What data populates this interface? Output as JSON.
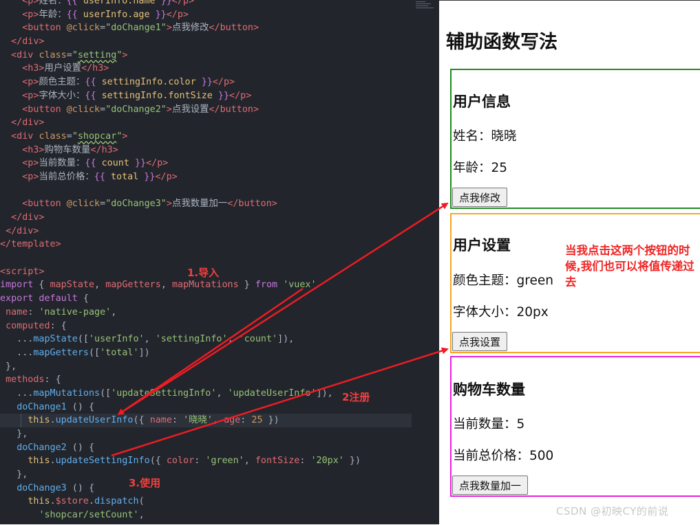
{
  "editor": {
    "lines": [
      [
        [
          "t-pun",
          "    "
        ],
        [
          "t-tag",
          "<p>"
        ],
        [
          "t-txt",
          "姓名："
        ],
        [
          "t-mus",
          "{{ "
        ],
        [
          "t-var",
          "userInfo.name"
        ],
        [
          "t-mus",
          " }}"
        ],
        [
          "t-tag",
          "</p>"
        ]
      ],
      [
        [
          "t-pun",
          "    "
        ],
        [
          "t-tag",
          "<p>"
        ],
        [
          "t-txt",
          "年龄："
        ],
        [
          "t-mus",
          "{{ "
        ],
        [
          "t-var",
          "userInfo.age"
        ],
        [
          "t-mus",
          " }}"
        ],
        [
          "t-tag",
          "</p>"
        ]
      ],
      [
        [
          "t-pun",
          "    "
        ],
        [
          "t-tag",
          "<button "
        ],
        [
          "t-attr",
          "@click"
        ],
        [
          "t-pun",
          "="
        ],
        [
          "t-str",
          "\"doChange1\""
        ],
        [
          "t-tag",
          ">"
        ],
        [
          "t-txt",
          "点我修改"
        ],
        [
          "t-tag",
          "</button>"
        ]
      ],
      [
        [
          "t-pun",
          "  "
        ],
        [
          "t-tag",
          "</div>"
        ]
      ],
      [
        [
          "t-pun",
          "  "
        ],
        [
          "t-tag",
          "<div "
        ],
        [
          "t-attr",
          "class"
        ],
        [
          "t-pun",
          "="
        ],
        [
          "t-str",
          "\""
        ],
        [
          "t-cls",
          "setting"
        ],
        [
          "t-str",
          "\""
        ],
        [
          "t-tag",
          ">"
        ]
      ],
      [
        [
          "t-pun",
          "    "
        ],
        [
          "t-tag",
          "<h3>"
        ],
        [
          "t-txt",
          "用户设置"
        ],
        [
          "t-tag",
          "</h3>"
        ]
      ],
      [
        [
          "t-pun",
          "    "
        ],
        [
          "t-tag",
          "<p>"
        ],
        [
          "t-txt",
          "颜色主题："
        ],
        [
          "t-mus",
          "{{ "
        ],
        [
          "t-var",
          "settingInfo.color"
        ],
        [
          "t-mus",
          " }}"
        ],
        [
          "t-tag",
          "</p>"
        ]
      ],
      [
        [
          "t-pun",
          "    "
        ],
        [
          "t-tag",
          "<p>"
        ],
        [
          "t-txt",
          "字体大小："
        ],
        [
          "t-mus",
          "{{ "
        ],
        [
          "t-var",
          "settingInfo.fontSize"
        ],
        [
          "t-mus",
          " }}"
        ],
        [
          "t-tag",
          "</p>"
        ]
      ],
      [
        [
          "t-pun",
          "    "
        ],
        [
          "t-tag",
          "<button "
        ],
        [
          "t-attr",
          "@click"
        ],
        [
          "t-pun",
          "="
        ],
        [
          "t-str",
          "\"doChange2\""
        ],
        [
          "t-tag",
          ">"
        ],
        [
          "t-txt",
          "点我设置"
        ],
        [
          "t-tag",
          "</button>"
        ]
      ],
      [
        [
          "t-pun",
          "  "
        ],
        [
          "t-tag",
          "</div>"
        ]
      ],
      [
        [
          "t-pun",
          "  "
        ],
        [
          "t-tag",
          "<div "
        ],
        [
          "t-attr",
          "class"
        ],
        [
          "t-pun",
          "="
        ],
        [
          "t-str",
          "\""
        ],
        [
          "t-cls",
          "shopcar"
        ],
        [
          "t-str",
          "\""
        ],
        [
          "t-tag",
          ">"
        ]
      ],
      [
        [
          "t-pun",
          "    "
        ],
        [
          "t-tag",
          "<h3>"
        ],
        [
          "t-txt",
          "购物车数量"
        ],
        [
          "t-tag",
          "</h3>"
        ]
      ],
      [
        [
          "t-pun",
          "    "
        ],
        [
          "t-tag",
          "<p>"
        ],
        [
          "t-txt",
          "当前数量："
        ],
        [
          "t-mus",
          "{{ "
        ],
        [
          "t-var",
          "count"
        ],
        [
          "t-mus",
          " }}"
        ],
        [
          "t-tag",
          "</p>"
        ]
      ],
      [
        [
          "t-pun",
          "    "
        ],
        [
          "t-tag",
          "<p>"
        ],
        [
          "t-txt",
          "当前总价格："
        ],
        [
          "t-mus",
          "{{ "
        ],
        [
          "t-var",
          "total"
        ],
        [
          "t-mus",
          " }}"
        ],
        [
          "t-tag",
          "</p>"
        ]
      ],
      [],
      [
        [
          "t-pun",
          "    "
        ],
        [
          "t-tag",
          "<button "
        ],
        [
          "t-attr",
          "@click"
        ],
        [
          "t-pun",
          "="
        ],
        [
          "t-str",
          "\"doChange3\""
        ],
        [
          "t-tag",
          ">"
        ],
        [
          "t-txt",
          "点我数量加一"
        ],
        [
          "t-tag",
          "</button>"
        ]
      ],
      [
        [
          "t-pun",
          "  "
        ],
        [
          "t-tag",
          "</div>"
        ]
      ],
      [
        [
          "t-pun",
          " "
        ],
        [
          "t-tag",
          "</div>"
        ]
      ],
      [
        [
          "t-tag",
          "</template>"
        ]
      ],
      [],
      [
        [
          "t-tag",
          "<script>"
        ]
      ],
      [
        [
          "t-kw",
          "import"
        ],
        [
          "t-pun",
          " { "
        ],
        [
          "t-prop",
          "mapState"
        ],
        [
          "t-pun",
          ", "
        ],
        [
          "t-prop",
          "mapGetters"
        ],
        [
          "t-pun",
          ", "
        ],
        [
          "t-prop",
          "mapMutations"
        ],
        [
          "t-pun",
          " } "
        ],
        [
          "t-kw",
          "from"
        ],
        [
          "t-pun",
          " "
        ],
        [
          "t-str",
          "'vuex'"
        ]
      ],
      [
        [
          "t-kw",
          "export default"
        ],
        [
          "t-pun",
          " {"
        ]
      ],
      [
        [
          "t-pun",
          " "
        ],
        [
          "t-prop",
          "name"
        ],
        [
          "t-pun",
          ": "
        ],
        [
          "t-str",
          "'native-page'"
        ],
        [
          "t-pun",
          ","
        ]
      ],
      [
        [
          "t-pun",
          " "
        ],
        [
          "t-prop",
          "computed"
        ],
        [
          "t-pun",
          ": {"
        ]
      ],
      [
        [
          "t-pun",
          "   ..."
        ],
        [
          "t-fn",
          "mapState"
        ],
        [
          "t-pun",
          "(["
        ],
        [
          "t-str",
          "'userInfo'"
        ],
        [
          "t-pun",
          ", "
        ],
        [
          "t-str",
          "'settingInfo'"
        ],
        [
          "t-pun",
          ", "
        ],
        [
          "t-str",
          "'count'"
        ],
        [
          "t-pun",
          "]),"
        ]
      ],
      [
        [
          "t-pun",
          "   ..."
        ],
        [
          "t-fn",
          "mapGetters"
        ],
        [
          "t-pun",
          "(["
        ],
        [
          "t-str",
          "'total'"
        ],
        [
          "t-pun",
          "])"
        ]
      ],
      [
        [
          "t-pun",
          " },"
        ]
      ],
      [
        [
          "t-pun",
          " "
        ],
        [
          "t-prop",
          "methods"
        ],
        [
          "t-pun",
          ": {"
        ]
      ],
      [
        [
          "t-pun",
          "   ..."
        ],
        [
          "t-fn",
          "mapMutations"
        ],
        [
          "t-pun",
          "(["
        ],
        [
          "t-str",
          "'updateSettingInfo'"
        ],
        [
          "t-pun",
          ", "
        ],
        [
          "t-str",
          "'updateUserInfo'"
        ],
        [
          "t-pun",
          "]),"
        ]
      ],
      [
        [
          "t-pun",
          "   "
        ],
        [
          "t-fn",
          "doChange1"
        ],
        [
          "t-pun",
          " () {"
        ]
      ],
      [
        [
          "t-pun",
          "     "
        ],
        [
          "t-this",
          "this"
        ],
        [
          "t-pun",
          "."
        ],
        [
          "t-fn",
          "updateUserInfo"
        ],
        [
          "t-pun",
          "({ "
        ],
        [
          "t-prop",
          "name"
        ],
        [
          "t-pun",
          ": "
        ],
        [
          "t-str",
          "'晓晓'"
        ],
        [
          "t-pun",
          ", "
        ],
        [
          "t-prop",
          "age"
        ],
        [
          "t-pun",
          ": "
        ],
        [
          "t-num",
          "25"
        ],
        [
          "t-pun",
          " })"
        ]
      ],
      [
        [
          "t-pun",
          "   },"
        ]
      ],
      [
        [
          "t-pun",
          "   "
        ],
        [
          "t-fn",
          "doChange2"
        ],
        [
          "t-pun",
          " () {"
        ]
      ],
      [
        [
          "t-pun",
          "     "
        ],
        [
          "t-this",
          "this"
        ],
        [
          "t-pun",
          "."
        ],
        [
          "t-fn",
          "updateSettingInfo"
        ],
        [
          "t-pun",
          "({ "
        ],
        [
          "t-prop",
          "color"
        ],
        [
          "t-pun",
          ": "
        ],
        [
          "t-str",
          "'green'"
        ],
        [
          "t-pun",
          ", "
        ],
        [
          "t-prop",
          "fontSize"
        ],
        [
          "t-pun",
          ": "
        ],
        [
          "t-str",
          "'20px'"
        ],
        [
          "t-pun",
          " })"
        ]
      ],
      [
        [
          "t-pun",
          "   },"
        ]
      ],
      [
        [
          "t-pun",
          "   "
        ],
        [
          "t-fn",
          "doChange3"
        ],
        [
          "t-pun",
          " () {"
        ]
      ],
      [
        [
          "t-pun",
          "     "
        ],
        [
          "t-this",
          "this"
        ],
        [
          "t-pun",
          "."
        ],
        [
          "t-prop",
          "$store"
        ],
        [
          "t-pun",
          "."
        ],
        [
          "t-fn",
          "dispatch"
        ],
        [
          "t-pun",
          "("
        ]
      ],
      [
        [
          "t-pun",
          "       "
        ],
        [
          "t-str",
          "'shopcar/setCount'"
        ],
        [
          "t-pun",
          ","
        ]
      ]
    ]
  },
  "annotations": {
    "import": "1.导入",
    "register": "2注册",
    "use": "3.使用",
    "note": "当我点击这两个按钮的时候,我们也可以将值传递过去"
  },
  "preview": {
    "title": "辅助函数写法",
    "user": {
      "heading": "用户信息",
      "name": "姓名：晓晓",
      "age": "年龄：25",
      "button": "点我修改"
    },
    "setting": {
      "heading": "用户设置",
      "color": "颜色主题：green",
      "font_size": "字体大小：20px",
      "button": "点我设置"
    },
    "shopcar": {
      "heading": "购物车数量",
      "count": "当前数量：5",
      "total": "当前总价格：500",
      "button": "点我数量加一"
    }
  },
  "watermark": "CSDN @初映CY的前说"
}
